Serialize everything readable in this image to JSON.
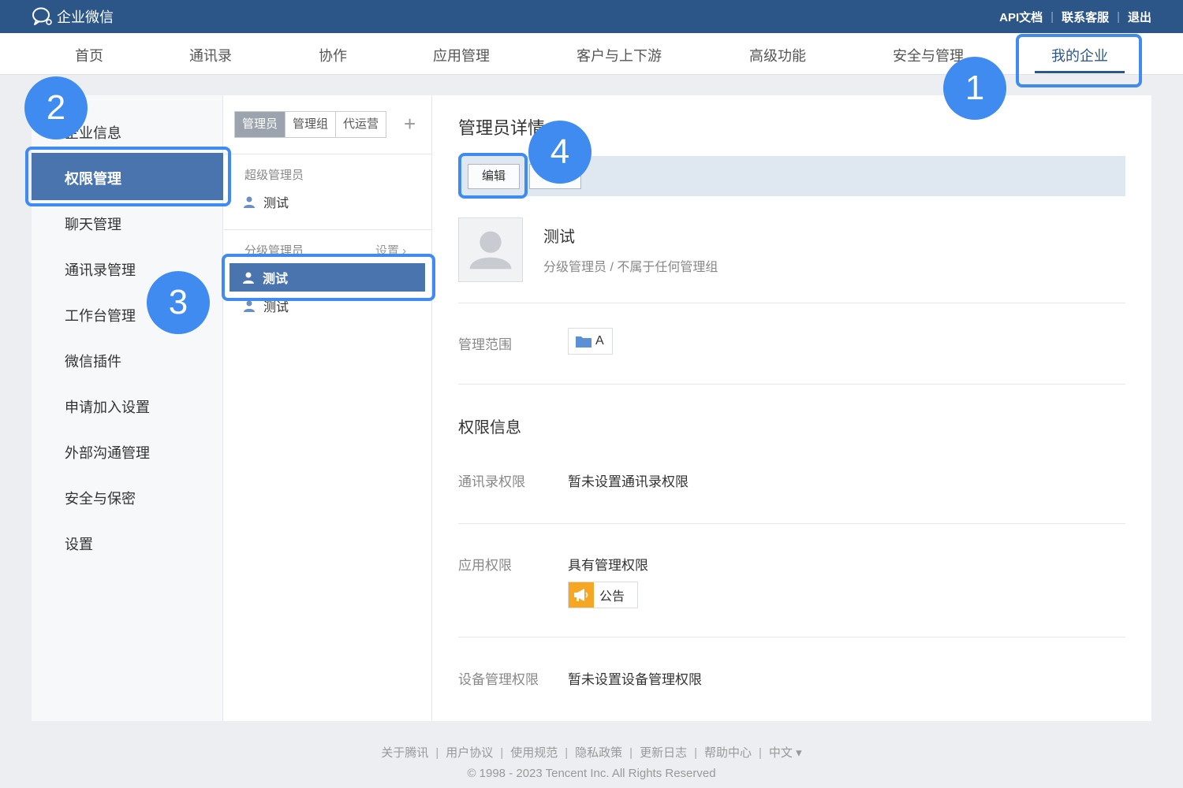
{
  "topbar": {
    "logo_text": "企业微信",
    "links": [
      "API文档",
      "联系客服",
      "退出"
    ]
  },
  "nav": {
    "items": [
      "首页",
      "通讯录",
      "协作",
      "应用管理",
      "客户与上下游",
      "高级功能",
      "安全与管理",
      "我的企业"
    ],
    "active_index": 7
  },
  "sidebar": {
    "items": [
      "企业信息",
      "权限管理",
      "聊天管理",
      "通讯录管理",
      "工作台管理",
      "微信插件",
      "申请加入设置",
      "外部沟通管理",
      "安全与保密",
      "设置"
    ],
    "active_index": 1
  },
  "middle": {
    "tabs": [
      "管理员",
      "管理组",
      "代运营"
    ],
    "active_tab": 0,
    "add_symbol": "+",
    "super_label": "超级管理员",
    "super_users": [
      "测试"
    ],
    "sub_label": "分级管理员",
    "sub_settings": "设置 ›",
    "sub_users": [
      "测试",
      "测试"
    ],
    "selected_sub_index": 0
  },
  "detail": {
    "title": "管理员详情",
    "edit_label": "编辑",
    "user_name": "测试",
    "user_role": "分级管理员 / 不属于任何管理组",
    "scope_label": "管理范围",
    "scope_value": "A",
    "perm_section": "权限信息",
    "contacts_perm_label": "通讯录权限",
    "contacts_perm_value": "暂未设置通讯录权限",
    "app_perm_label": "应用权限",
    "app_perm_value": "具有管理权限",
    "app_name": "公告",
    "device_perm_label": "设备管理权限",
    "device_perm_value": "暂未设置设备管理权限"
  },
  "footer": {
    "links": [
      "关于腾讯",
      "用户协议",
      "使用规范",
      "隐私政策",
      "更新日志",
      "帮助中心",
      "中文 ▾"
    ],
    "copyright": "© 1998 - 2023 Tencent Inc. All Rights Reserved"
  },
  "annotations": [
    "1",
    "2",
    "3",
    "4"
  ],
  "colors": {
    "brand": "#2d5688",
    "selected": "#4a74ad",
    "highlight": "#3f8bf0",
    "announce_icon": "#f5a623"
  },
  "icons": {
    "logo": "wecom-chat-icon",
    "user": "user-icon",
    "folder": "folder-icon",
    "announce": "megaphone-icon"
  }
}
